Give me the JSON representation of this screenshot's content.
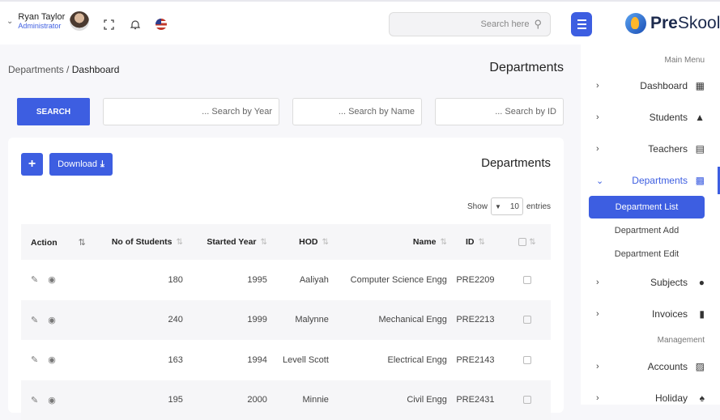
{
  "user": {
    "name": "Ryan Taylor",
    "role": "Administrator"
  },
  "topbar": {
    "search_placeholder": "Search here",
    "icons": [
      "fullscreen-icon",
      "bell-icon",
      "us-flag-icon"
    ]
  },
  "brand": {
    "name_prefix": "Pre",
    "name_suffix": "Skool"
  },
  "breadcrumb": {
    "parent": "Departments",
    "separator": "/",
    "current": "Dashboard"
  },
  "page_title": "Departments",
  "filters": {
    "search_button": "SEARCH",
    "year_placeholder": "... Search by Year",
    "name_placeholder": "... Search by Name",
    "id_placeholder": "... Search by ID"
  },
  "card": {
    "title": "Departments",
    "add_label": "+",
    "download_label": "Download",
    "show_label": "Show",
    "entries_value": "10",
    "entries_label": "entries"
  },
  "table": {
    "headers": [
      "Action",
      "No of Students",
      "Started Year",
      "HOD",
      "Name",
      "ID"
    ],
    "rows": [
      {
        "students": "180",
        "year": "1995",
        "hod": "Aaliyah",
        "name": "Computer Science Engg",
        "id": "PRE2209"
      },
      {
        "students": "240",
        "year": "1999",
        "hod": "Malynne",
        "name": "Mechanical Engg",
        "id": "PRE2213"
      },
      {
        "students": "163",
        "year": "1994",
        "hod": "Levell Scott",
        "name": "Electrical Engg",
        "id": "PRE2143"
      },
      {
        "students": "195",
        "year": "2000",
        "hod": "Minnie",
        "name": "Civil Engg",
        "id": "PRE2431"
      }
    ]
  },
  "sidebar": {
    "main_menu_title": "Main Menu",
    "management_title": "Management",
    "items": [
      {
        "label": "Dashboard",
        "icon": "dashboard-icon"
      },
      {
        "label": "Students",
        "icon": "graduation-cap-icon"
      },
      {
        "label": "Teachers",
        "icon": "chalkboard-teacher-icon"
      },
      {
        "label": "Departments",
        "icon": "building-icon"
      },
      {
        "label": "Subjects",
        "icon": "book-reader-icon"
      },
      {
        "label": "Invoices",
        "icon": "clipboard-icon"
      },
      {
        "label": "Accounts",
        "icon": "file-invoice-icon"
      },
      {
        "label": "Holiday",
        "icon": "holiday-icon"
      }
    ],
    "department_sub": [
      "Department List",
      "Department Add",
      "Department Edit"
    ]
  },
  "colors": {
    "accent": "#3d5ee1",
    "background": "#f7f7fa"
  }
}
